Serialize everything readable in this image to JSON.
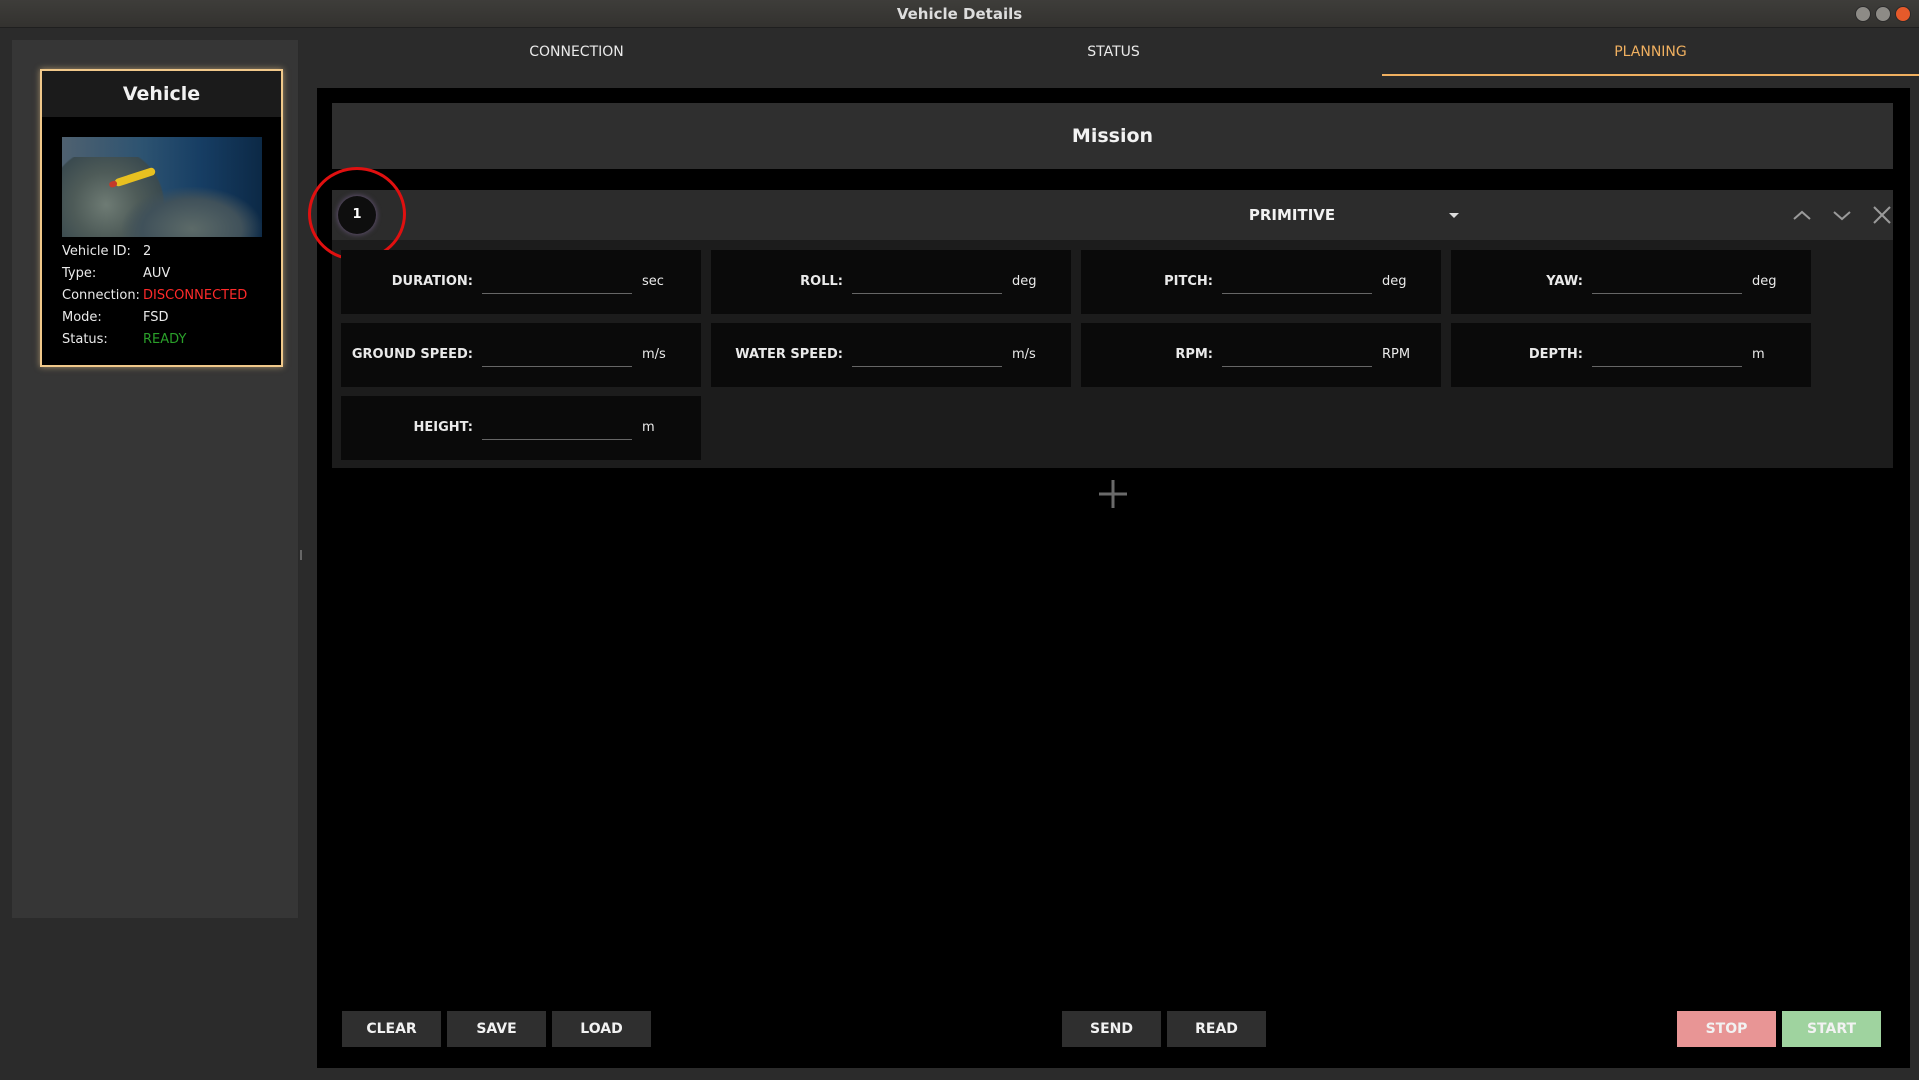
{
  "window": {
    "title": "Vehicle Details"
  },
  "vehicle_card": {
    "title": "Vehicle",
    "info": [
      {
        "label": "Vehicle ID:",
        "value": "2"
      },
      {
        "label": "Type:",
        "value": "AUV"
      },
      {
        "label": "Connection:",
        "value": "DISCONNECTED"
      },
      {
        "label": "Mode:",
        "value": "FSD"
      },
      {
        "label": "Status:",
        "value": "READY"
      }
    ],
    "colors": {
      "disconnected": "#ff2a2a",
      "ready": "#2aa02a",
      "border": "#f0c88a"
    }
  },
  "tabs": [
    {
      "label": "CONNECTION"
    },
    {
      "label": "STATUS"
    },
    {
      "label": "PLANNING"
    }
  ],
  "mission": {
    "title": "Mission",
    "primitive": {
      "step": "1",
      "selected": "PRIMITIVE",
      "fields": [
        {
          "label": "DURATION:",
          "unit": "sec",
          "value": ""
        },
        {
          "label": "ROLL:",
          "unit": "deg",
          "value": ""
        },
        {
          "label": "PITCH:",
          "unit": "deg",
          "value": ""
        },
        {
          "label": "YAW:",
          "unit": "deg",
          "value": ""
        },
        {
          "label": "GROUND SPEED:",
          "unit": "m/s",
          "value": ""
        },
        {
          "label": "WATER SPEED:",
          "unit": "m/s",
          "value": ""
        },
        {
          "label": "RPM:",
          "unit": "RPM",
          "value": ""
        },
        {
          "label": "DEPTH:",
          "unit": "m",
          "value": ""
        },
        {
          "label": "HEIGHT:",
          "unit": "m",
          "value": ""
        }
      ]
    }
  },
  "buttons": {
    "clear": "CLEAR",
    "save": "SAVE",
    "load": "LOAD",
    "send": "SEND",
    "read": "READ",
    "stop": "STOP",
    "start": "START"
  },
  "icons": {
    "move_up": "chevron-up-icon",
    "move_down": "chevron-down-icon",
    "remove": "close-icon",
    "add": "plus-icon"
  },
  "colors": {
    "accent": "#f0b060",
    "stop_button": "#e89595",
    "start_button": "#9fd39f",
    "highlight_ring": "#e01010"
  }
}
